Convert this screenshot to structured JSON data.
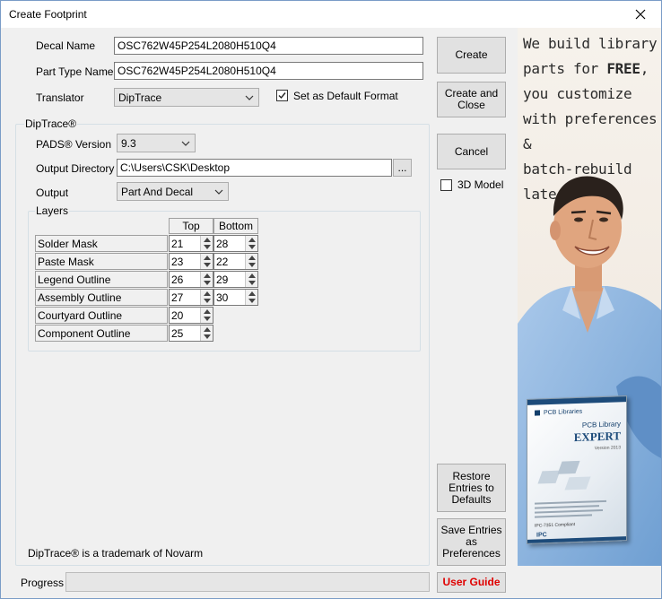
{
  "window": {
    "title": "Create Footprint"
  },
  "fields": {
    "decal_name_label": "Decal Name",
    "decal_name_value": "OSC762W45P254L2080H510Q4",
    "part_type_label": "Part Type Name",
    "part_type_value": "OSC762W45P254L2080H510Q4",
    "translator_label": "Translator",
    "translator_value": "DipTrace",
    "default_format_label": "Set as Default Format",
    "default_format_checked": true
  },
  "diptrace": {
    "group_title": "DipTrace®",
    "pads_version_label": "PADS® Version",
    "pads_version_value": "9.3",
    "output_dir_label": "Output Directory",
    "output_dir_value": "C:\\Users\\CSK\\Desktop",
    "browse_label": "...",
    "output_label": "Output",
    "output_value": "Part And Decal",
    "trademark": "DipTrace® is a trademark of Novarm"
  },
  "layers": {
    "group_title": "Layers",
    "col_top": "Top",
    "col_bottom": "Bottom",
    "rows": [
      {
        "name": "Solder Mask",
        "top": "21",
        "bottom": "28"
      },
      {
        "name": "Paste Mask",
        "top": "23",
        "bottom": "22"
      },
      {
        "name": "Legend Outline",
        "top": "26",
        "bottom": "29"
      },
      {
        "name": "Assembly Outline",
        "top": "27",
        "bottom": "30"
      },
      {
        "name": "Courtyard Outline",
        "top": "20"
      },
      {
        "name": "Component Outline",
        "top": "25"
      }
    ]
  },
  "buttons": {
    "create": "Create",
    "create_close_1": "Create and",
    "create_close_2": "Close",
    "cancel": "Cancel",
    "model_3d": "3D Model",
    "restore_1": "Restore",
    "restore_2": "Entries to",
    "restore_3": "Defaults",
    "save_1": "Save Entries",
    "save_2": "as",
    "save_3": "Preferences",
    "user_guide": "User Guide"
  },
  "progress": {
    "label": "Progress",
    "value": 0
  },
  "ad": {
    "line1": "We build library",
    "line2a": "parts for ",
    "line2b": "FREE",
    "line2c": ",",
    "line3": "you customize",
    "line4": "with preferences &",
    "line5": "batch-rebuild later!",
    "box_brand": "PCB Libraries",
    "box_product_top": "PCB Library",
    "box_product": "EXPERT",
    "box_version": "Version 2013",
    "box_ipc": "IPC-7351 Compliant",
    "box_ipc_logo": "IPC"
  },
  "colors": {
    "user_guide": "#e00000",
    "accent": "#0078d7"
  }
}
